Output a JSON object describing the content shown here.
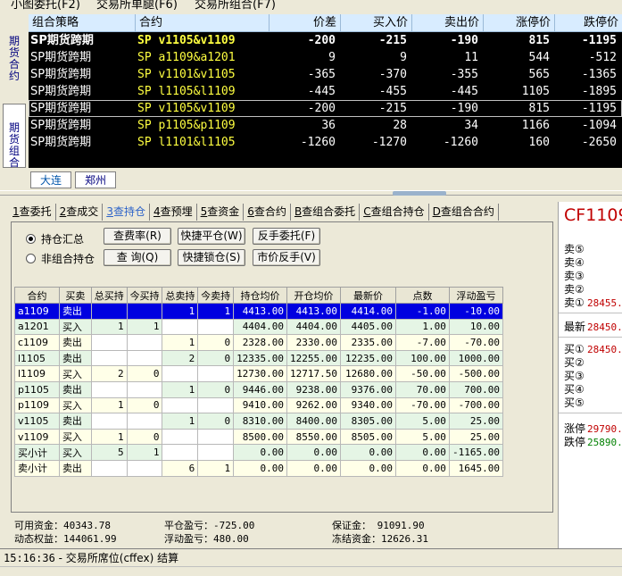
{
  "menu": {
    "items": [
      "小图委托(F2)",
      "交易所单腿(F6)",
      "交易所组合(F7)"
    ]
  },
  "vtabs": {
    "futures_contract": "期\n货\n合\n约",
    "futures_combo": "期\n货\n组\n合"
  },
  "quote": {
    "headers": [
      "组合策略",
      "合约",
      "价差",
      "买入价",
      "卖出价",
      "涨停价",
      "跌停价"
    ],
    "rows": [
      {
        "name": "SP期货跨期",
        "code": "SP  v1105&v1109",
        "spread": "-200",
        "bid": "-215",
        "ask": "-190",
        "up": "815",
        "down": "-1195"
      },
      {
        "name": "SP期货跨期",
        "code": "SP  a1109&a1201",
        "spread": "9",
        "bid": "9",
        "ask": "11",
        "up": "544",
        "down": "-512"
      },
      {
        "name": "SP期货跨期",
        "code": "SP  v1101&v1105",
        "spread": "-365",
        "bid": "-370",
        "ask": "-355",
        "up": "565",
        "down": "-1365"
      },
      {
        "name": "SP期货跨期",
        "code": "SP  l1105&l1109",
        "spread": "-445",
        "bid": "-455",
        "ask": "-445",
        "up": "1105",
        "down": "-1895"
      },
      {
        "name": "SP期货跨期",
        "code": "SP  v1105&v1109",
        "spread": "-200",
        "bid": "-215",
        "ask": "-190",
        "up": "815",
        "down": "-1195"
      },
      {
        "name": "SP期货跨期",
        "code": "SP  p1105&p1109",
        "spread": "36",
        "bid": "28",
        "ask": "34",
        "up": "1166",
        "down": "-1094"
      },
      {
        "name": "SP期货跨期",
        "code": "SP  l1101&l1105",
        "spread": "-1260",
        "bid": "-1270",
        "ask": "-1260",
        "up": "160",
        "down": "-2650"
      }
    ]
  },
  "exchange_tabs": [
    "大连",
    "郑州"
  ],
  "query_tabs": [
    {
      "key": "1",
      "label": "查委托"
    },
    {
      "key": "2",
      "label": "查成交"
    },
    {
      "key": "3",
      "label": "查持仓"
    },
    {
      "key": "4",
      "label": "查预埋"
    },
    {
      "key": "5",
      "label": "查资金"
    },
    {
      "key": "6",
      "label": "查合约"
    },
    {
      "key": "B",
      "label": "查组合委托"
    },
    {
      "key": "C",
      "label": "查组合持仓"
    },
    {
      "key": "D",
      "label": "查组合合约"
    }
  ],
  "options": {
    "pos_summary": "持仓汇总",
    "non_combo": "非组合持仓"
  },
  "buttons": {
    "fee_rate": "查费率(R)",
    "quick_close": "快捷平仓(W)",
    "reverse_order": "反手委托(F)",
    "query": "查 询(Q)",
    "quick_lock": "快捷锁仓(S)",
    "market_reverse": "市价反手(V)"
  },
  "grid": {
    "headers": [
      "合约",
      "买卖",
      "总买持",
      "今买持",
      "总卖持",
      "今卖持",
      "持仓均价",
      "开仓均价",
      "最新价",
      "点数",
      "浮动盈亏"
    ],
    "rows": [
      [
        "a1109",
        "卖出",
        "",
        "",
        "1",
        "1",
        "4413.00",
        "4413.00",
        "4414.00",
        "-1.00",
        "-10.00"
      ],
      [
        "a1201",
        "买入",
        "1",
        "1",
        "",
        "",
        "4404.00",
        "4404.00",
        "4405.00",
        "1.00",
        "10.00"
      ],
      [
        "c1109",
        "卖出",
        "",
        "",
        "1",
        "0",
        "2328.00",
        "2330.00",
        "2335.00",
        "-7.00",
        "-70.00"
      ],
      [
        "l1105",
        "卖出",
        "",
        "",
        "2",
        "0",
        "12335.00",
        "12255.00",
        "12235.00",
        "100.00",
        "1000.00"
      ],
      [
        "l1109",
        "买入",
        "2",
        "0",
        "",
        "",
        "12730.00",
        "12717.50",
        "12680.00",
        "-50.00",
        "-500.00"
      ],
      [
        "p1105",
        "卖出",
        "",
        "",
        "1",
        "0",
        "9446.00",
        "9238.00",
        "9376.00",
        "70.00",
        "700.00"
      ],
      [
        "p1109",
        "买入",
        "1",
        "0",
        "",
        "",
        "9410.00",
        "9262.00",
        "9340.00",
        "-70.00",
        "-700.00"
      ],
      [
        "v1105",
        "卖出",
        "",
        "",
        "1",
        "0",
        "8310.00",
        "8400.00",
        "8305.00",
        "5.00",
        "25.00"
      ],
      [
        "v1109",
        "买入",
        "1",
        "0",
        "",
        "",
        "8500.00",
        "8550.00",
        "8505.00",
        "5.00",
        "25.00"
      ],
      [
        "买小计",
        "买入",
        "5",
        "1",
        "",
        "",
        "0.00",
        "0.00",
        "0.00",
        "0.00",
        "-1165.00"
      ],
      [
        "卖小计",
        "卖出",
        "",
        "",
        "6",
        "1",
        "0.00",
        "0.00",
        "0.00",
        "0.00",
        "1645.00"
      ]
    ]
  },
  "summary": {
    "available": "可用资金：40343.78",
    "dynamic": "动态权益：144061.99",
    "close_pl": "平仓盈亏：-725.00",
    "float_pl": "浮动盈亏：480.00",
    "margin": "保证金：  91091.90",
    "frozen": "冻结资金：12626.31"
  },
  "book": {
    "code": "CF1109",
    "asks": [
      {
        "label": "卖⑤",
        "value": ""
      },
      {
        "label": "卖④",
        "value": ""
      },
      {
        "label": "卖③",
        "value": ""
      },
      {
        "label": "卖②",
        "value": ""
      },
      {
        "label": "卖①",
        "value": "28455."
      }
    ],
    "last_label": "最新",
    "last_value": "28450.",
    "bids": [
      {
        "label": "买①",
        "value": "28450."
      },
      {
        "label": "买②",
        "value": ""
      },
      {
        "label": "买③",
        "value": ""
      },
      {
        "label": "买④",
        "value": ""
      },
      {
        "label": "买⑤",
        "value": ""
      }
    ],
    "up_label": "涨停",
    "up_value": "29790.",
    "down_label": "跌停",
    "down_value": "25890."
  },
  "status": {
    "time": "15:16:36",
    "text": " - 交易所席位(cffex) 结算"
  },
  "colors": {
    "quote_bg": "#000000",
    "spread_name": "#ffffff",
    "code": "#ffff40",
    "selected_row": "#0000e0",
    "book_red": "#c00000",
    "book_green": "#008000"
  }
}
